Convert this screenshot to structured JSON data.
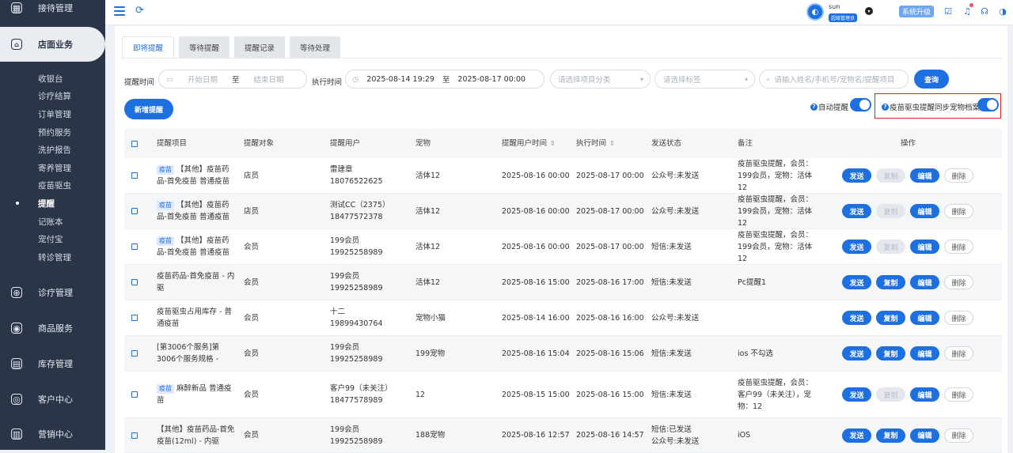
{
  "sidebar": {
    "top_item": "接待管理",
    "active_group": "店面业务",
    "sub_items": [
      "收银台",
      "诊疗结算",
      "订单管理",
      "预约服务",
      "洗护报告",
      "寄养管理",
      "疫苗驱虫",
      "提醒",
      "记账本",
      "宠付宝",
      "转诊管理"
    ],
    "active_sub": 7,
    "groups": [
      "诊疗管理",
      "商品服务",
      "库存管理",
      "客户中心",
      "营销中心"
    ]
  },
  "topbar": {
    "user_name": "sun",
    "user_role": "超级管理员",
    "upgrade": "系统升级"
  },
  "tabs": [
    "即将提醒",
    "等待提醒",
    "提醒记录",
    "等待处理"
  ],
  "filters": {
    "remind_time_label": "提醒时间",
    "start_ph": "开始日期",
    "to1": "至",
    "end_ph": "结束日期",
    "exec_time_label": "执行时间",
    "exec_start": "2025-08-14 19:29",
    "to2": "至",
    "exec_end": "2025-08-17 00:00",
    "category_ph": "请选择项目分类",
    "tag_ph": "请选择标签",
    "search_ph": "请输入姓名/手机号/宠物名/提醒项目",
    "query": "查询"
  },
  "new_button": "新增提醒",
  "auto_remind": "自动提醒",
  "sync_label": "疫苗驱虫提醒同步宠物档案",
  "accent": "#1e6fe0",
  "table": {
    "headers": [
      "提醒项目",
      "提醒对象",
      "提醒用户",
      "宠物",
      "提醒用户时间",
      "执行时间",
      "发送状态",
      "备注",
      "操作"
    ],
    "actions": {
      "send": "发送",
      "copy": "复制",
      "edit": "编辑",
      "delete": "删除"
    },
    "rows": [
      {
        "tag": "疫苗",
        "item": "【其他】疫苗药品-首免疫苗 普通疫苗",
        "target": "店员",
        "user1": "雷建章",
        "user2": "18076522625",
        "pet": "活体12",
        "rtime": "2025-08-16 00:00",
        "etime": "2025-08-17 00:00",
        "status": "公众号:未发送",
        "status2": "",
        "note": "疫苗驱虫提醒，会员：199会员，宠物：活体12",
        "copy_disabled": true
      },
      {
        "tag": "疫苗",
        "item": "【其他】疫苗药品-首免疫苗 普通疫苗",
        "target": "店员",
        "user1": "测试CC（2375）",
        "user2": "18477572378",
        "pet": "活体12",
        "rtime": "2025-08-16 00:00",
        "etime": "2025-08-17 00:00",
        "status": "公众号:未发送",
        "status2": "",
        "note": "疫苗驱虫提醒，会员：199会员，宠物：活体12",
        "copy_disabled": true
      },
      {
        "tag": "疫苗",
        "item": "【其他】疫苗药品-首免疫苗 普通疫苗",
        "target": "会员",
        "user1": "199会员",
        "user2": "19925258989",
        "pet": "活体12",
        "rtime": "2025-08-16 00:00",
        "etime": "2025-08-17 00:00",
        "status": "短信:未发送",
        "status2": "",
        "note": "疫苗驱虫提醒，会员：199会员，宠物：活体12",
        "copy_disabled": true
      },
      {
        "tag": "",
        "item": "疫苗药品-首免疫苗 - 内驱",
        "target": "会员",
        "user1": "199会员",
        "user2": "19925258989",
        "pet": "活体12",
        "rtime": "2025-08-16 15:00",
        "etime": "2025-08-16 17:00",
        "status": "短信:未发送",
        "status2": "",
        "note": "Pc提醒1",
        "copy_disabled": false
      },
      {
        "tag": "",
        "item": "疫苗驱虫占用库存 - 普通疫苗",
        "target": "会员",
        "user1": "十二",
        "user2": "19899430764",
        "pet": "宠物小猫",
        "rtime": "2025-08-14 16:00",
        "etime": "2025-08-16 16:00",
        "status": "公众号:未发送",
        "status2": "",
        "note": "",
        "copy_disabled": false
      },
      {
        "tag": "",
        "item": "[第3006个服务]第3006个服务规格 -",
        "target": "会员",
        "user1": "199会员",
        "user2": "19925258989",
        "pet": "199宠物",
        "rtime": "2025-08-16 15:04",
        "etime": "2025-08-16 15:06",
        "status": "短信:未发送",
        "status2": "",
        "note": "ios 不勾选",
        "copy_disabled": false
      },
      {
        "tag": "疫苗",
        "item": "麻醉新品 普通疫苗",
        "target": "会员",
        "user1": "客户99（未关注）",
        "user2": "18477578989",
        "pet": "12",
        "rtime": "2025-08-15 15:00",
        "etime": "2025-08-16 15:00",
        "status": "短信:未发送",
        "status2": "",
        "note": "疫苗驱虫提醒，会员：客户99（未关注），宠物：12",
        "copy_disabled": true
      },
      {
        "tag": "",
        "item": "【其他】疫苗药品-首免疫苗(12ml) - 内驱",
        "target": "会员",
        "user1": "199会员",
        "user2": "19925258989",
        "pet": "188宠物",
        "rtime": "2025-08-16 12:57",
        "etime": "2025-08-16 14:57",
        "status": "短信:已发送",
        "status2": "公众号:未发送",
        "note": "iOS",
        "copy_disabled": false
      }
    ]
  }
}
